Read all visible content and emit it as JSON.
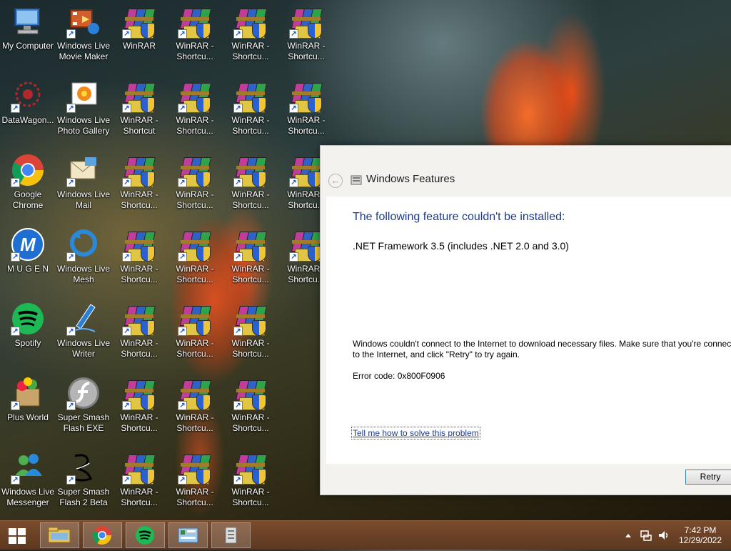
{
  "desktop": {
    "icons": [
      {
        "label": "My Computer",
        "icon": "computer-icon"
      },
      {
        "label": "Windows Live Movie Maker",
        "icon": "movie-maker-icon"
      },
      {
        "label": "WinRAR",
        "icon": "winrar-icon"
      },
      {
        "label": "WinRAR - Shortcu...",
        "icon": "winrar-icon"
      },
      {
        "label": "WinRAR - Shortcu...",
        "icon": "winrar-icon"
      },
      {
        "label": "WinRAR - Shortcu...",
        "icon": "winrar-icon"
      },
      {
        "label": "DataWagon...",
        "icon": "datawagon-icon"
      },
      {
        "label": "Windows Live Photo Gallery",
        "icon": "photo-gallery-icon"
      },
      {
        "label": "WinRAR - Shortcut",
        "icon": "winrar-icon"
      },
      {
        "label": "WinRAR - Shortcu...",
        "icon": "winrar-icon"
      },
      {
        "label": "WinRAR - Shortcu...",
        "icon": "winrar-icon"
      },
      {
        "label": "WinRAR - Shortcu...",
        "icon": "winrar-icon"
      },
      {
        "label": "Google Chrome",
        "icon": "chrome-icon"
      },
      {
        "label": "Windows Live Mail",
        "icon": "live-mail-icon"
      },
      {
        "label": "WinRAR - Shortcu...",
        "icon": "winrar-icon"
      },
      {
        "label": "WinRAR - Shortcu...",
        "icon": "winrar-icon"
      },
      {
        "label": "WinRAR - Shortcu...",
        "icon": "winrar-icon"
      },
      {
        "label": "WinRAR - Shortcu...",
        "icon": "winrar-icon"
      },
      {
        "label": "M U G E N",
        "icon": "mugen-icon"
      },
      {
        "label": "Windows Live Mesh",
        "icon": "live-mesh-icon"
      },
      {
        "label": "WinRAR - Shortcu...",
        "icon": "winrar-icon"
      },
      {
        "label": "WinRAR - Shortcu...",
        "icon": "winrar-icon"
      },
      {
        "label": "WinRAR - Shortcu...",
        "icon": "winrar-icon"
      },
      {
        "label": "WinRAR - Shortcu...",
        "icon": "winrar-icon"
      },
      {
        "label": "Spotify",
        "icon": "spotify-icon"
      },
      {
        "label": "Windows Live Writer",
        "icon": "live-writer-icon"
      },
      {
        "label": "WinRAR - Shortcu...",
        "icon": "winrar-icon"
      },
      {
        "label": "WinRAR - Shortcu...",
        "icon": "winrar-icon"
      },
      {
        "label": "WinRAR - Shortcu...",
        "icon": "winrar-icon"
      },
      {
        "label": "Plus World",
        "icon": "plus-world-icon"
      },
      {
        "label": "Super Smash Flash EXE",
        "icon": "flash-icon"
      },
      {
        "label": "WinRAR - Shortcu...",
        "icon": "winrar-icon"
      },
      {
        "label": "WinRAR - Shortcu...",
        "icon": "winrar-icon"
      },
      {
        "label": "WinRAR - Shortcu...",
        "icon": "winrar-icon"
      },
      {
        "label": "Windows Live Messenger",
        "icon": "messenger-icon"
      },
      {
        "label": "Super Smash Flash 2 Beta",
        "icon": "ssf2-icon"
      },
      {
        "label": "WinRAR - Shortcu...",
        "icon": "winrar-icon"
      },
      {
        "label": "WinRAR - Shortcu...",
        "icon": "winrar-icon"
      },
      {
        "label": "WinRAR - Shortcu...",
        "icon": "winrar-icon"
      }
    ]
  },
  "window": {
    "title": "Windows Features",
    "heading": "The following feature couldn't be installed:",
    "feature": ".NET Framework 3.5 (includes .NET 2.0 and 3.0)",
    "message": "Windows couldn't connect to the Internet to download necessary files. Make sure that you're connected to the Internet, and click \"Retry\" to try again.",
    "error_code": "Error code: 0x800F0906",
    "help_link": "Tell me how to solve this problem",
    "retry_label": "Retry"
  },
  "taskbar": {
    "pinned": [
      {
        "name": "file-explorer-icon"
      },
      {
        "name": "chrome-icon"
      },
      {
        "name": "spotify-icon"
      },
      {
        "name": "control-panel-icon"
      },
      {
        "name": "windows-features-icon"
      }
    ],
    "clock": {
      "time": "7:42 PM",
      "date": "12/29/2022"
    }
  }
}
